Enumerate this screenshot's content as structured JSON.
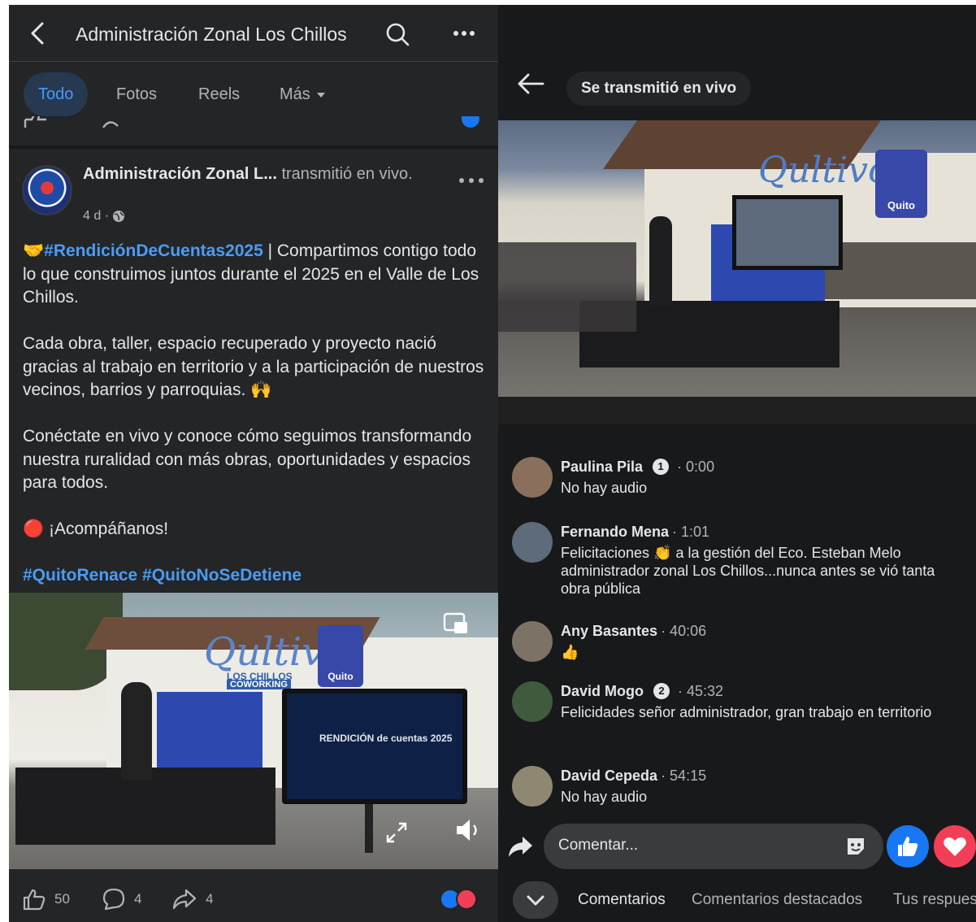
{
  "left": {
    "header": {
      "title": "Administración Zonal Los Chillos"
    },
    "tabs": [
      {
        "label": "Todo",
        "active": true
      },
      {
        "label": "Fotos",
        "active": false
      },
      {
        "label": "Reels",
        "active": false
      },
      {
        "label": "Más",
        "active": false
      }
    ],
    "post": {
      "author": "Administración Zonal L...",
      "action": " transmitió en vivo.",
      "time": "4 d ·",
      "hashtag_main": "#RendiciónDeCuentas2025",
      "p1_rest": " | Compartimos contigo todo lo que construimos juntos durante el 2025 en el Valle de Los Chillos.",
      "p2": "Cada obra, taller, espacio recuperado y proyecto nació gracias al trabajo en territorio y a la participación de nuestros vecinos, barrios y parroquias. 🙌",
      "p3": "Conéctate en vivo y conoce cómo seguimos transformando nuestra ruralidad con más obras, oportunidades y espacios para todos.",
      "p4": "🔴 ¡Acompáñanos!",
      "hashtags": "#QuitoRenace #QuitoNoSeDetiene",
      "photo_sign": "Qultivo",
      "photo_sign_sub": "LOS CHILLOS",
      "photo_sign_sub2": "COWORKING",
      "photo_logo": "Quito",
      "photo_screen": "RENDICIÓN de cuentas 2025",
      "likes": "50",
      "comments": "4",
      "shares": "4"
    }
  },
  "right": {
    "live_label": "Se transmitió en vivo",
    "video_sign": "Qultivo",
    "video_logo": "Quito",
    "comments": [
      {
        "name": "Paulina Pila",
        "badge": "1",
        "time": "· 0:00",
        "text": "No hay audio",
        "avatar_color": "#8a6f5c"
      },
      {
        "name": "Fernando Mena",
        "badge": "",
        "time": "· 1:01",
        "text": "Felicitaciones 👏 a la gestión del Eco. Esteban Melo administrador zonal Los Chillos...nunca antes se vió tanta obra pública",
        "avatar_color": "#5d6b7a"
      },
      {
        "name": "Any Basantes",
        "badge": "",
        "time": "· 40:06",
        "text": "👍",
        "avatar_color": "#7d7266"
      },
      {
        "name": "David Mogo",
        "badge": "2",
        "time": "· 45:32",
        "text": "Felicidades señor administrador, gran trabajo en territorio",
        "avatar_color": "#3f5a3c"
      },
      {
        "name": "David Cepeda",
        "badge": "",
        "time": "· 54:15",
        "text": "No hay audio",
        "avatar_color": "#8e8772"
      }
    ],
    "composer_placeholder": "Comentar...",
    "tabs": [
      {
        "label": "Comentarios",
        "active": true
      },
      {
        "label": "Comentarios destacados",
        "active": false
      },
      {
        "label": "Tus respuestas",
        "active": false
      }
    ]
  },
  "colors": {
    "panel_bg": "#242526",
    "dark_bg": "#18191a",
    "accent_blue": "#4599ff",
    "hashtag_blue": "#4b9cf5",
    "like_blue": "#1877f2",
    "love_red": "#f33e58"
  },
  "icons": [
    "back-arrow-icon",
    "search-icon",
    "more-icon",
    "globe-icon",
    "like-icon",
    "comment-icon",
    "share-icon",
    "sticker-icon",
    "chevron-down-icon",
    "picture-in-picture-icon",
    "expand-icon",
    "volume-icon"
  ]
}
